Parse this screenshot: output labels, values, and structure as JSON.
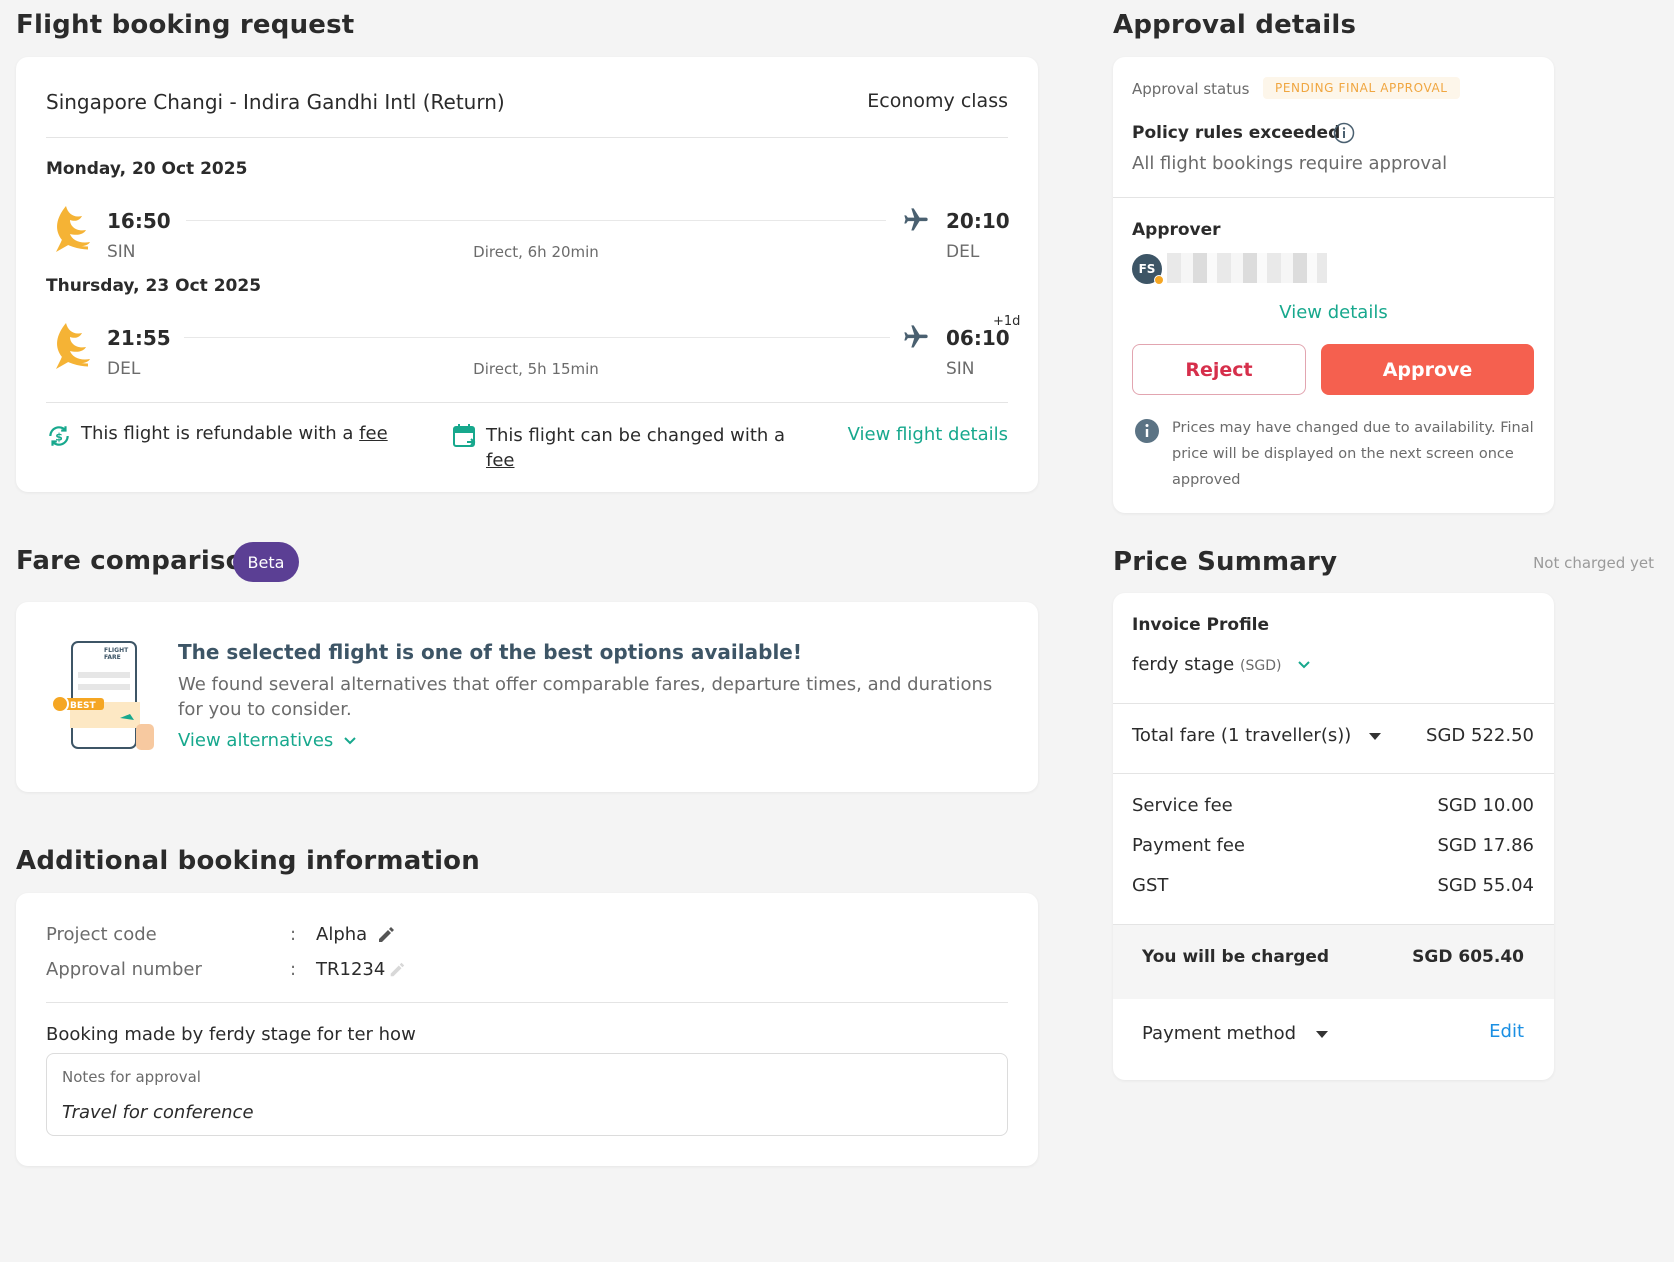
{
  "booking": {
    "title": "Flight booking request",
    "route": "Singapore Changi - Indira Gandhi Intl (Return)",
    "cabin": "Economy class",
    "outbound": {
      "date": "Monday, 20 Oct 2025",
      "dep_time": "16:50",
      "dep_code": "SIN",
      "arr_time": "20:10",
      "arr_code": "DEL",
      "duration": "Direct, 6h 20min"
    },
    "inbound": {
      "date": "Thursday, 23 Oct 2025",
      "dep_time": "21:55",
      "dep_code": "DEL",
      "arr_time": "06:10",
      "arr_code": "SIN",
      "day_offset": "+1d",
      "duration": "Direct, 5h 15min"
    },
    "refund_text": "This flight is refundable with a",
    "refund_link": "fee",
    "change_text": "This flight can be changed with a",
    "change_link": "fee",
    "view_details": "View flight details"
  },
  "fare": {
    "title": "Fare comparison",
    "badge": "Beta",
    "headline": "The selected flight is one of the best options available!",
    "body": "We found several alternatives that offer comparable fares, departure times, and durations for you to consider.",
    "link": "View alternatives",
    "illus_label1": "FLIGHT",
    "illus_label2": "FARE",
    "illus_best": "BEST"
  },
  "additional": {
    "title": "Additional booking information",
    "fields": [
      {
        "label": "Project code",
        "value": "Alpha"
      },
      {
        "label": "Approval number",
        "value": "TR1234"
      }
    ],
    "separator": ":",
    "booked_by": "Booking made by ferdy stage for ter how",
    "notes_label": "Notes for approval",
    "notes_value": "Travel for conference"
  },
  "approval": {
    "title": "Approval details",
    "status_label": "Approval status",
    "status_value": "PENDING FINAL APPROVAL",
    "policy_title": "Policy rules exceeded",
    "policy_text": "All flight bookings require approval",
    "approver_label": "Approver",
    "approver_initials": "FS",
    "view_details": "View details",
    "reject": "Reject",
    "approve": "Approve",
    "notice": "Prices may have changed due to availability. Final price will be displayed on the next screen once approved"
  },
  "price": {
    "title": "Price Summary",
    "not_charged": "Not charged yet",
    "invoice_label": "Invoice Profile",
    "invoice_name": "ferdy stage",
    "invoice_currency": "(SGD)",
    "total_fare_label": "Total fare (1 traveller(s))",
    "total_fare_value": "SGD 522.50",
    "fees": [
      {
        "label": "Service fee",
        "value": "SGD 10.00"
      },
      {
        "label": "Payment fee",
        "value": "SGD 17.86"
      },
      {
        "label": "GST",
        "value": "SGD 55.04"
      }
    ],
    "charged_label": "You will be charged",
    "charged_value": "SGD 605.40",
    "payment_label": "Payment method",
    "edit": "Edit"
  },
  "colors": {
    "accent": "#17a88d",
    "approve": "#f5604f",
    "reject": "#d62f4b",
    "beta": "#5b3f94",
    "pending": "#f0a640",
    "link_blue": "#1a8fe3"
  }
}
